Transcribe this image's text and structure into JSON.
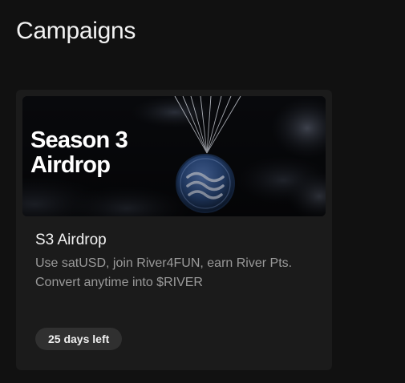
{
  "page": {
    "title": "Campaigns"
  },
  "campaign": {
    "banner_line1": "Season 3",
    "banner_line2": "Airdrop",
    "name": "S3 Airdrop",
    "description": "Use satUSD, join River4FUN, earn River Pts. Convert anytime into $RIVER",
    "badge": "25 days left",
    "banner_icon": "river-coin-parachute-icon"
  },
  "colors": {
    "background": "#111111",
    "card": "#1b1b1b",
    "badge": "#303030",
    "accent": "#2d4f88"
  }
}
